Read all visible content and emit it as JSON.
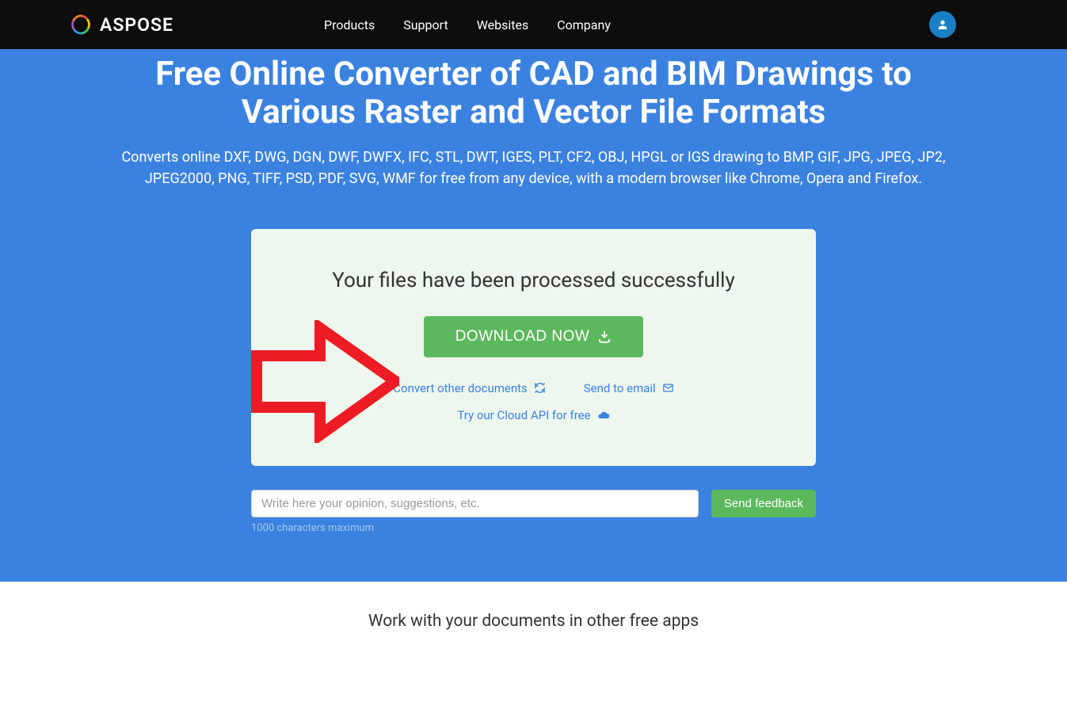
{
  "header": {
    "brand": "ASPOSE",
    "nav": [
      "Products",
      "Support",
      "Websites",
      "Company"
    ]
  },
  "hero": {
    "title": "Free Online Converter of CAD and BIM Drawings to Various Raster and Vector File Formats",
    "subtitle": "Converts online DXF, DWG, DGN, DWF, DWFX, IFC, STL, DWT, IGES, PLT, CF2, OBJ, HPGL or IGS drawing to BMP, GIF, JPG, JPEG, JP2, JPEG2000, PNG, TIFF, PSD, PDF, SVG, WMF for free from any device, with a modern browser like Chrome, Opera and Firefox."
  },
  "card": {
    "status": "Your files have been processed successfully",
    "download_label": "DOWNLOAD NOW",
    "convert_other": "Convert other documents",
    "send_email": "Send to email",
    "cloud_api": "Try our Cloud API for free"
  },
  "feedback": {
    "placeholder": "Write here your opinion, suggestions, etc.",
    "button": "Send feedback",
    "note": "1000 characters maximum"
  },
  "other_apps": {
    "title": "Work with your documents in other free apps"
  }
}
